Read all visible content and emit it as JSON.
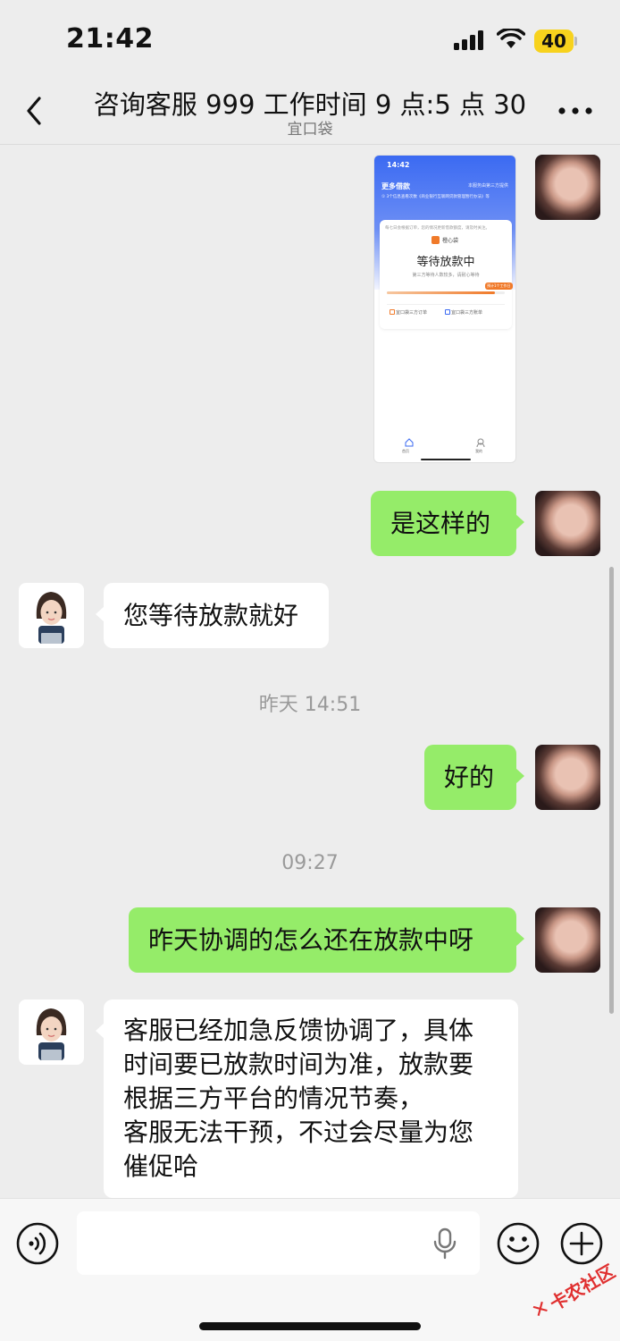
{
  "status_bar": {
    "time": "21:42",
    "battery": "40",
    "signal_icon": "signal-bars-icon",
    "wifi_icon": "wifi-icon"
  },
  "nav": {
    "title": "咨询客服 999 工作时间 9 点:5 点 30",
    "subtitle": "宜口袋",
    "back_icon": "back-chevron-icon",
    "more_icon": "more-dots-icon"
  },
  "messages": {
    "screenshot": {
      "time": "14:42",
      "header": "更多借款",
      "header_right": "本服务由第三方提供",
      "notice": "① 3个信息查看次数《商业银行互联网贷款管理暂行办法》等",
      "card_tip": "每七日会根据订单，您的情况更新借款额度，请及时关注。",
      "brand": "橙心袋",
      "status": "等待放款中",
      "sub": "第三方等待人数较多，请耐心等待",
      "progress_tag": "预计1个工作日",
      "progress": 0.92,
      "link1": "宜口袋三方订单",
      "link2": "宜口袋三方账单",
      "tab_home": "首页",
      "tab_me": "我的"
    },
    "m1": "是这样的",
    "m2": "您等待放款就好",
    "t1": "昨天 14:51",
    "m3": "好的",
    "t2": "09:27",
    "m4": "昨天协调的怎么还在放款中呀",
    "m5_lines": [
      "客服已经加急反馈协调了，具体",
      "时间要已放款时间为准，放款要",
      "根据三方平台的情况节奏，",
      "客服无法干预，不过会尽量为您",
      "催促哈"
    ]
  },
  "input_bar": {
    "placeholder": "",
    "voice_icon": "voice-icon",
    "mic_icon": "mic-icon",
    "emoji_icon": "emoji-icon",
    "plus_icon": "plus-icon"
  },
  "watermark": {
    "text": "卡农社区"
  },
  "colors": {
    "sent_bubble": "#95ec69",
    "received_bubble": "#ffffff",
    "background": "#ededed"
  }
}
